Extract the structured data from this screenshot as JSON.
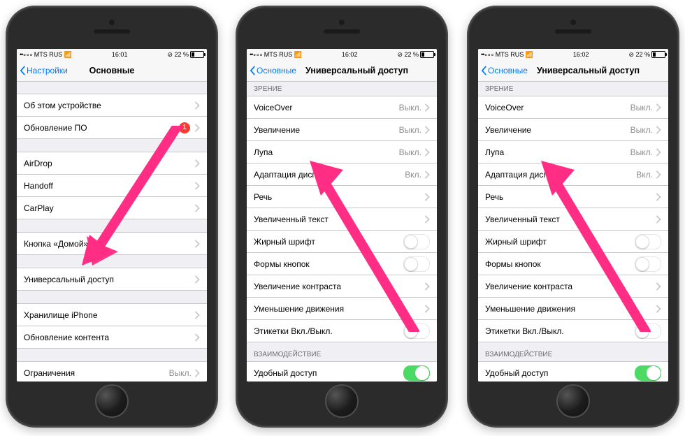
{
  "status": {
    "carrier": "MTS RUS",
    "battery_text": "22 %",
    "bt_icon": "ᚼ"
  },
  "phone1": {
    "time": "16:01",
    "back": "Настройки",
    "title": "Основные",
    "rows": {
      "about": "Об этом устройстве",
      "update": "Обновление ПО",
      "update_badge": "1",
      "airdrop": "AirDrop",
      "handoff": "Handoff",
      "carplay": "CarPlay",
      "home": "Кнопка «Домой»",
      "accessibility": "Универсальный доступ",
      "storage": "Хранилище iPhone",
      "bgrefresh": "Обновление контента",
      "restrictions": "Ограничения",
      "restrictions_val": "Выкл."
    }
  },
  "phone2": {
    "time": "16:02",
    "back": "Основные",
    "title": "Универсальный доступ",
    "section_vision": "Зрение",
    "section_interaction": "Взаимодействие",
    "rows": {
      "voiceover": "VoiceOver",
      "voiceover_val": "Выкл.",
      "zoom": "Увеличение",
      "zoom_val": "Выкл.",
      "magnifier": "Лупа",
      "magnifier_val": "Выкл.",
      "display": "Адаптация дисплея",
      "display_val": "Вкл.",
      "speech": "Речь",
      "largetext": "Увеличенный текст",
      "bold": "Жирный шрифт",
      "buttonshapes": "Формы кнопок",
      "contrast": "Увеличение контраста",
      "reducemotion": "Уменьшение движения",
      "onoff": "Этикетки Вкл./Выкл.",
      "reachability": "Удобный доступ"
    }
  }
}
